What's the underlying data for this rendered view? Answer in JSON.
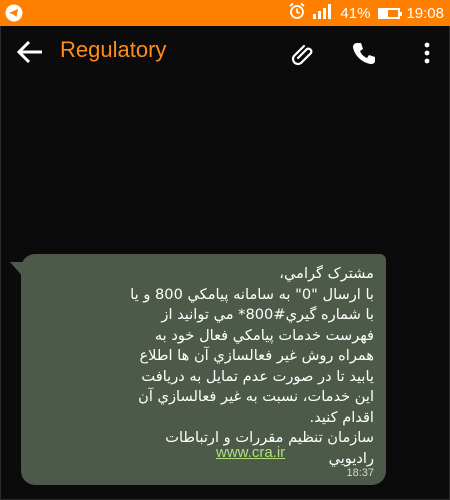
{
  "status_bar": {
    "battery_percent": "41%",
    "battery_level": 0.41,
    "time": "19:08",
    "left_icon": "telegram-icon",
    "right_icons": [
      "alarm-icon",
      "signal-icon",
      "battery-icon"
    ]
  },
  "app_bar": {
    "title": "Regulatory",
    "back_icon": "back-arrow-icon",
    "actions": [
      "attach-icon",
      "call-icon",
      "more-vert-icon"
    ]
  },
  "message": {
    "text": "مشترک گرامي،\nبا ارسال \"0\" به سامانه پيامکي 800 و يا\nبا شماره گيري#800* مي توانيد از\nفهرست خدمات پيامکي فعال خود به\nهمراه روش غير فعالسازي آن ها اطلاع\nيابيد تا در صورت عدم تمايل به دريافت\nاين خدمات، نسبت به غير فعالسازي آن\nاقدام کنيد.\nسازمان تنظيم مقررات و ارتباطات\nراديويي",
    "link": "www.cra.ir",
    "time": "18:37"
  },
  "colors": {
    "accent": "#ff7f00",
    "title": "#ff8c1a",
    "background": "#0b0b0b",
    "bubble": "#4d5a49",
    "link": "#aee07a"
  }
}
